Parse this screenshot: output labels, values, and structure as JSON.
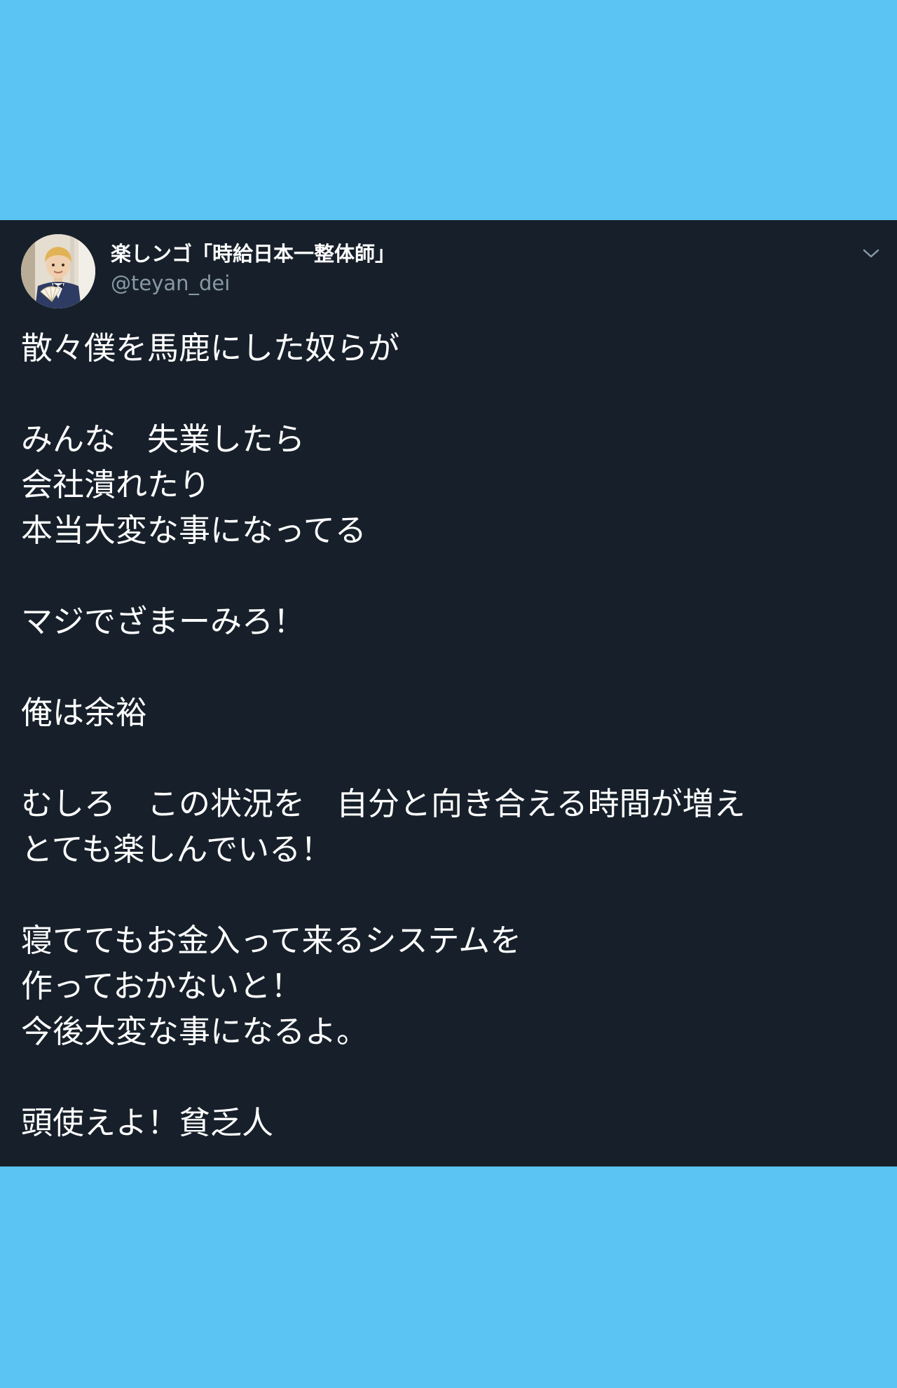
{
  "tweet": {
    "author": {
      "display_name": "楽しンゴ「時給日本一整体師」",
      "handle": "@teyan_dei"
    },
    "menu_icon": "chevron-down-icon",
    "text": "散々僕を馬鹿にした奴らが\n\nみんな　失業したら\n会社潰れたり\n本当大変な事になってる\n\nマジでざまーみろ！\n\n俺は余裕\n\nむしろ　この状況を　自分と向き合える時間が増え\nとても楽しんでいる！\n\n寝ててもお金入って来るシステムを\n作っておかないと！\n今後大変な事になるよ。\n\n頭使えよ！貧乏人"
  },
  "colors": {
    "page_background": "#5bc4f2",
    "card_background": "#17202a",
    "text_primary": "#ffffff",
    "text_secondary": "#8899a6"
  }
}
